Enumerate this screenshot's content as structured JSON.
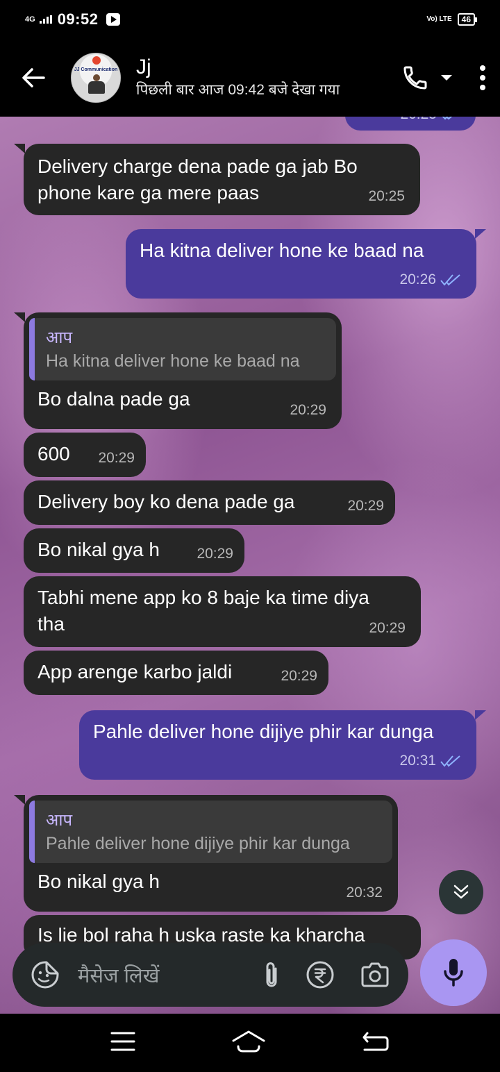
{
  "status_bar": {
    "network": "4G",
    "time": "09:52",
    "volte": "Vo) LTE",
    "battery": "46"
  },
  "header": {
    "contact_name": "Jj",
    "last_seen": "पिछली बार आज 09:42 बजे देखा गया",
    "avatar_text": "JJ Communication"
  },
  "messages": [
    {
      "text": "Delivery charge dena pade ga jab Bo phone kare ga mere paas",
      "time": "20:25"
    },
    {
      "text": "Ha kitna deliver hone ke baad na",
      "time": "20:26"
    },
    {
      "quote_author": "आप",
      "quote_text": "Ha kitna deliver hone ke baad na",
      "text": "Bo dalna pade ga",
      "time": "20:29"
    },
    {
      "text": "600",
      "time": "20:29"
    },
    {
      "text": "Delivery boy ko dena pade ga",
      "time": "20:29"
    },
    {
      "text": "Bo nikal gya h",
      "time": "20:29"
    },
    {
      "text": "Tabhi mene app ko 8 baje ka time diya tha",
      "time": "20:29"
    },
    {
      "text": "App arenge karbo jaldi",
      "time": "20:29"
    },
    {
      "text": "Pahle deliver hone dijiye phir kar dunga",
      "time": "20:31"
    },
    {
      "quote_author": "आप",
      "quote_text": "Pahle deliver hone dijiye phir kar dunga",
      "text": "Bo nikal gya h",
      "time": "20:32"
    },
    {
      "text": "Is lie bol raha h uska raste ka kharcha"
    }
  ],
  "partial_top_time": "20:25",
  "composer": {
    "placeholder": "मैसेज लिखें"
  },
  "colors": {
    "incoming_bubble": "#262626",
    "outgoing_bubble": "#4a3a9c",
    "read_ticks": "#8fb4ff",
    "mic_button": "#a996f2"
  }
}
